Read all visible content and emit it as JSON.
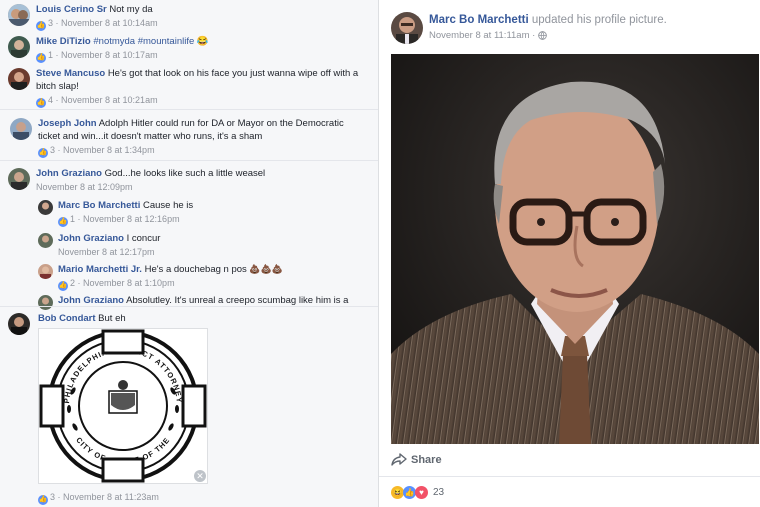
{
  "comments": [
    {
      "author": "Louis Cerino Sr",
      "text": "Not my da",
      "likes": "3",
      "time": "November 8 at 10:14am",
      "avatar": "avatar-louis"
    },
    {
      "author": "Mike DiTizio",
      "text": "#notmyda #mountainlife 😂",
      "likes": "1",
      "time": "November 8 at 10:17am",
      "avatar": "avatar-mike"
    },
    {
      "author": "Steve Mancuso",
      "text": "He's got that look on his face you just wanna wipe off with a bitch slap!",
      "likes": "4",
      "time": "November 8 at 10:21am",
      "avatar": "avatar-steve"
    },
    {
      "author": "Joseph John",
      "text": "Adolph Hitler could run for DA or Mayor on the Democratic ticket and win...it doesn't matter who runs, it's a sham",
      "likes": "3",
      "time": "November 8 at 1:34pm",
      "avatar": "avatar-joseph"
    },
    {
      "author": "John Graziano",
      "text": "God...he looks like such a little weasel",
      "likes": "",
      "time": "November 8 at 12:09pm",
      "avatar": "avatar-john"
    }
  ],
  "replies": [
    {
      "author": "Marc Bo Marchetti",
      "text": "Cause he is",
      "likes": "1",
      "time": "November 8 at 12:16pm"
    },
    {
      "author": "John Graziano",
      "text": "I concur",
      "likes": "",
      "time": "November 8 at 12:17pm"
    },
    {
      "author": "Mario Marchetti Jr.",
      "text": "He's a douchebag n pos",
      "emoji": "💩💩💩",
      "likes": "2",
      "time": "November 8 at 1:10pm"
    },
    {
      "author": "John Graziano",
      "text": "Absolutley. It's unreal a creepo scumbag like him is a",
      "likes": "",
      "time": ""
    }
  ],
  "last_comment": {
    "author": "Bob Condart",
    "text": "But eh",
    "likes": "3",
    "time": "November 8 at 11:23am"
  },
  "seal": {
    "ring_text_top": "PHILADELPHIA DISTRICT ATTORNEY",
    "ring_text_bottom": "CITY OF OFFICE OF THE"
  },
  "post": {
    "author": "Marc Bo Marchetti",
    "action": "updated his profile picture.",
    "time": "November 8 at 11:11am",
    "privacy_icon": "globe-icon",
    "share_label": "Share",
    "reaction_count": "23",
    "reactions": [
      "haha",
      "like",
      "love"
    ]
  },
  "colors": {
    "link": "#365899",
    "like": "#5890ff",
    "love": "#f25268",
    "haha": "#f7b928",
    "meta": "#90949c"
  }
}
